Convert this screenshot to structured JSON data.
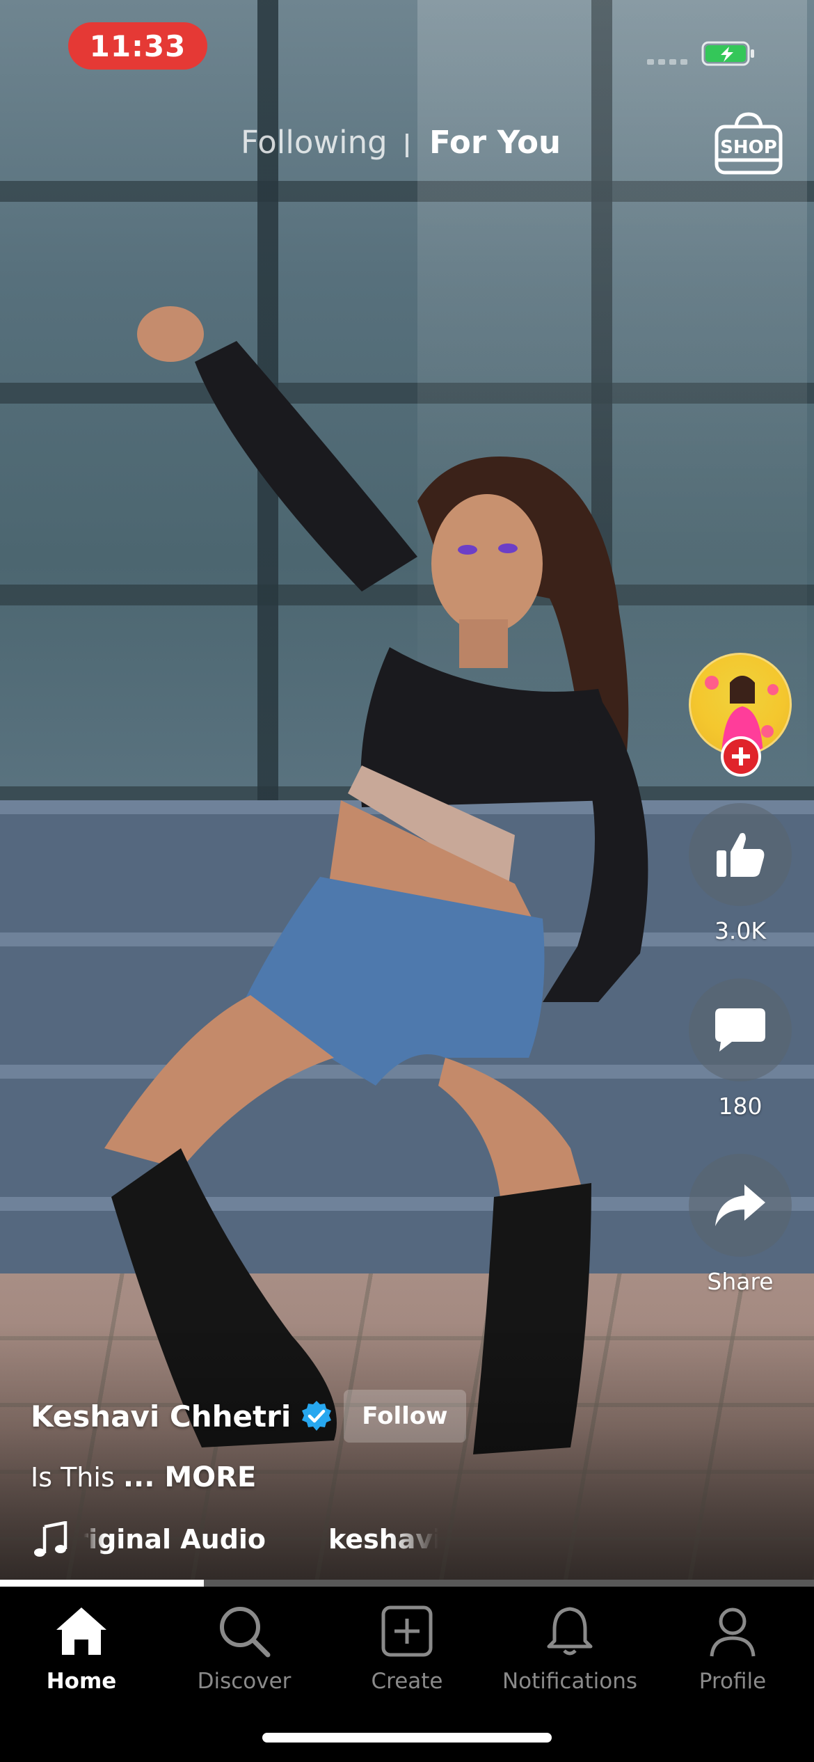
{
  "status_bar": {
    "time": "11:33",
    "battery_state": "charging",
    "accent_time_bg": "#e53935",
    "battery_color": "#34c759"
  },
  "top_tabs": {
    "following": "Following",
    "for_you": "For You",
    "active": "For You",
    "shop_label": "SHOP"
  },
  "actions": {
    "like_count": "3.0K",
    "comment_count": "180",
    "share_label": "Share",
    "follow_badge_color": "#e0242b"
  },
  "post": {
    "creator_name": "Keshavi Chhetri",
    "verified": true,
    "follow_label": "Follow",
    "caption": "Is This ",
    "more_label": "... MORE",
    "audio_title": "Original Audio",
    "audio_user": "keshavichh"
  },
  "progress": {
    "fraction": 0.25
  },
  "tab_bar": {
    "items": [
      {
        "label": "Home",
        "icon": "home-icon",
        "active": true
      },
      {
        "label": "Discover",
        "icon": "search-icon",
        "active": false
      },
      {
        "label": "Create",
        "icon": "create-icon",
        "active": false
      },
      {
        "label": "Notifications",
        "icon": "bell-icon",
        "active": false
      },
      {
        "label": "Profile",
        "icon": "person-icon",
        "active": false
      }
    ]
  }
}
